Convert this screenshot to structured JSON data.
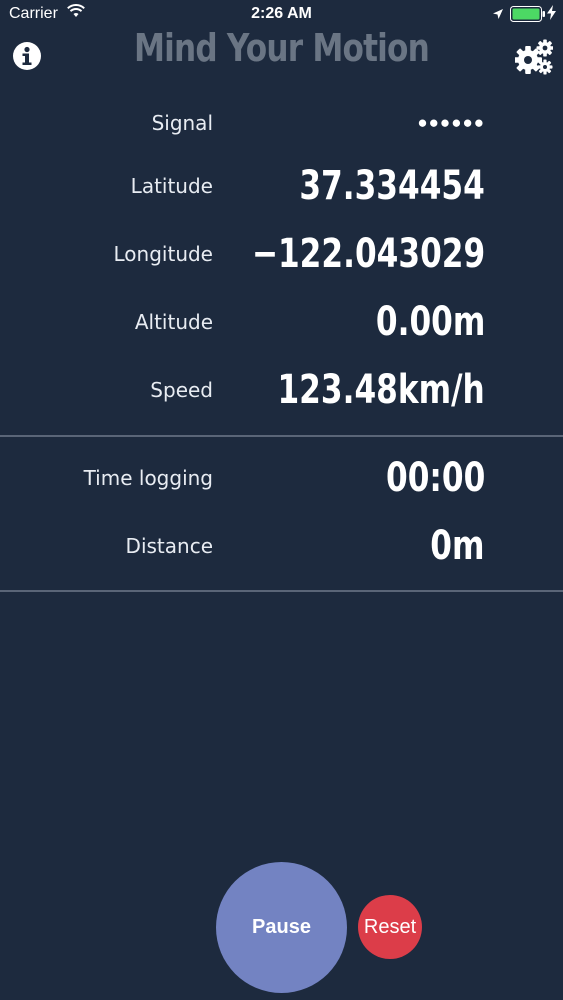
{
  "status_bar": {
    "carrier": "Carrier",
    "time": "2:26 AM"
  },
  "header": {
    "title": "Mind Your Motion",
    "info_icon": "info-icon",
    "settings_icon": "gear-icon"
  },
  "location": {
    "signal_label": "Signal",
    "signal_value": "●●●●●●",
    "latitude_label": "Latitude",
    "latitude_value": "37.334454",
    "longitude_label": "Longitude",
    "longitude_value": "−122.043029",
    "altitude_label": "Altitude",
    "altitude_value": "0.00m",
    "speed_label": "Speed",
    "speed_value": "123.48km/h"
  },
  "logging": {
    "time_label": "Time logging",
    "time_value": "00:00",
    "distance_label": "Distance",
    "distance_value": "0m"
  },
  "controls": {
    "pause_label": "Pause",
    "reset_label": "Reset"
  },
  "colors": {
    "background": "#1d2a3e",
    "title": "#6a7584",
    "pause_button": "#7383c2",
    "reset_button": "#dc3d49",
    "battery": "#4cd964"
  }
}
